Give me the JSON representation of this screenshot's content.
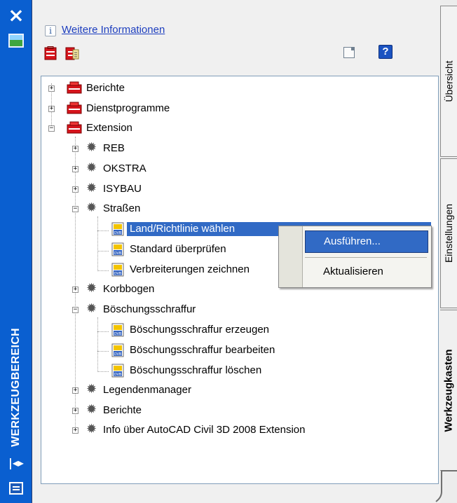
{
  "palette": {
    "panel_blue": "#0a5fd0",
    "selection": "#316ac5",
    "link": "#1e3fbf"
  },
  "window": {
    "title_vertical": "WERKZEUGBEREICH",
    "close_icon": "close-icon",
    "autohide_icon": "autohide-icon",
    "properties_icon": "properties-icon"
  },
  "header": {
    "more_info_link": "Weitere Informationen",
    "info_icon_glyph": "i",
    "help_glyph": "?"
  },
  "tabs": [
    {
      "label": "Übersicht",
      "active": false
    },
    {
      "label": "Einstellungen",
      "active": false
    },
    {
      "label": "Werkzeugkasten",
      "active": true
    }
  ],
  "tree": [
    {
      "label": "Berichte",
      "level": 0,
      "icon": "toolbox",
      "expanded": false
    },
    {
      "label": "Dienstprogramme",
      "level": 0,
      "icon": "toolbox",
      "expanded": false
    },
    {
      "label": "Extension",
      "level": 0,
      "icon": "toolbox",
      "expanded": true
    },
    {
      "label": "REB",
      "level": 1,
      "icon": "gear",
      "expanded": false
    },
    {
      "label": "OKSTRA",
      "level": 1,
      "icon": "gear",
      "expanded": false
    },
    {
      "label": "ISYBAU",
      "level": 1,
      "icon": "gear",
      "expanded": false
    },
    {
      "label": "Straßen",
      "level": 1,
      "icon": "gear",
      "expanded": true
    },
    {
      "label": "Land/Richtlinie wählen",
      "level": 2,
      "icon": "dvb",
      "selected": true
    },
    {
      "label": "Standard überprüfen",
      "level": 2,
      "icon": "dvb"
    },
    {
      "label": "Verbreiterungen zeichnen",
      "level": 2,
      "icon": "dvb"
    },
    {
      "label": "Korbbogen",
      "level": 1,
      "icon": "gear",
      "expanded": false
    },
    {
      "label": "Böschungsschraffur",
      "level": 1,
      "icon": "gear",
      "expanded": true
    },
    {
      "label": "Böschungsschraffur erzeugen",
      "level": 2,
      "icon": "dvb"
    },
    {
      "label": "Böschungsschraffur bearbeiten",
      "level": 2,
      "icon": "dvb"
    },
    {
      "label": "Böschungsschraffur löschen",
      "level": 2,
      "icon": "dvb"
    },
    {
      "label": "Legendenmanager",
      "level": 1,
      "icon": "gear",
      "expanded": false
    },
    {
      "label": "Berichte",
      "level": 1,
      "icon": "gear",
      "expanded": false
    },
    {
      "label": "Info über AutoCAD Civil 3D 2008 Extension",
      "level": 1,
      "icon": "gear",
      "expanded": false
    }
  ],
  "context_menu": {
    "items": [
      {
        "label": "Ausführen...",
        "highlighted": true
      },
      {
        "label": "Aktualisieren",
        "highlighted": false
      }
    ]
  }
}
